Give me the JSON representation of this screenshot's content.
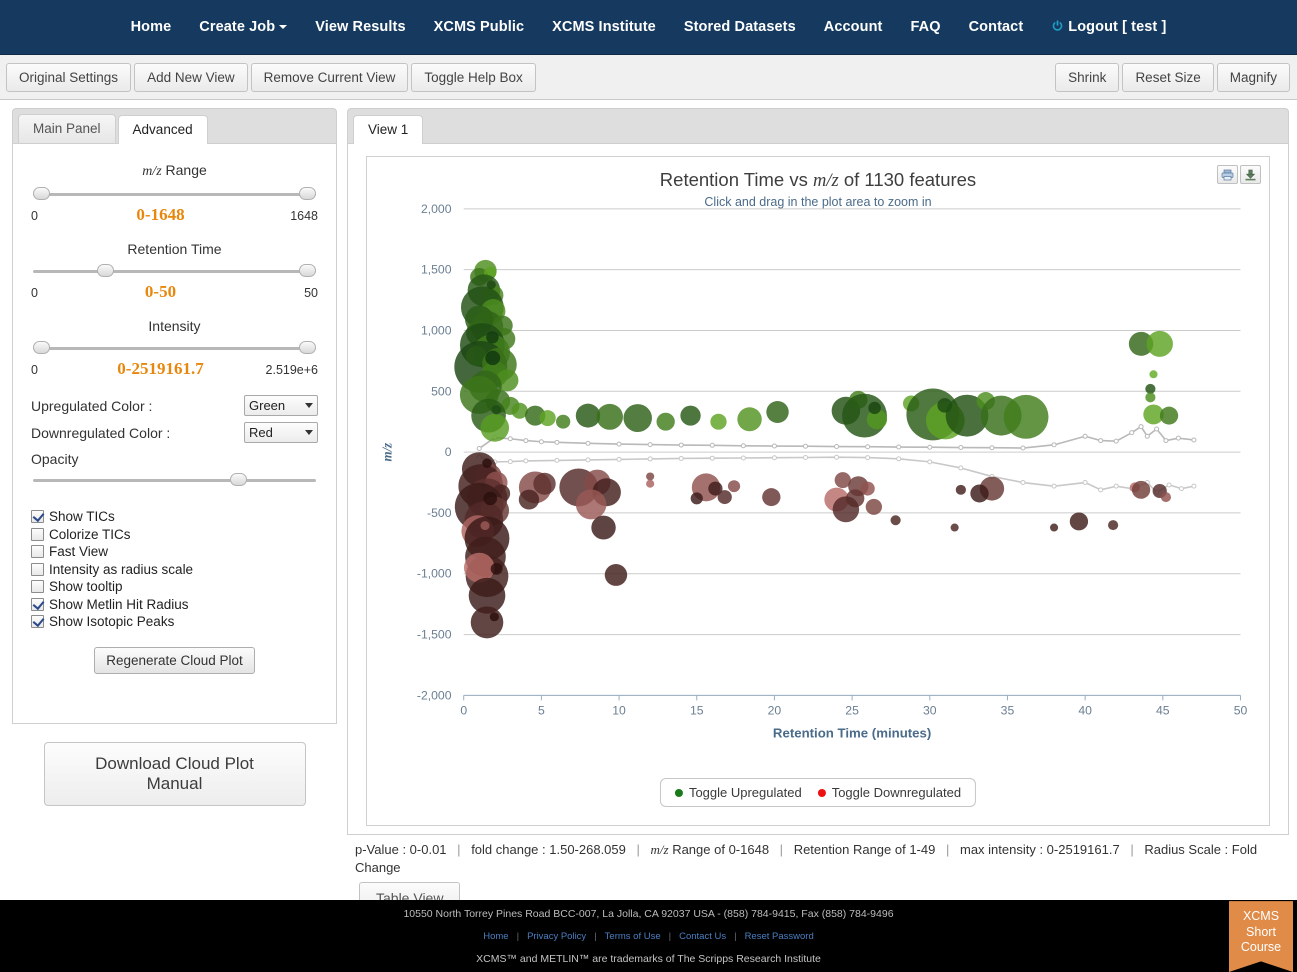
{
  "navbar": {
    "items": [
      {
        "label": "Home",
        "caret": false
      },
      {
        "label": "Create Job",
        "caret": true
      },
      {
        "label": "View Results",
        "caret": false
      },
      {
        "label": "XCMS Public",
        "caret": false
      },
      {
        "label": "XCMS Institute",
        "caret": false
      },
      {
        "label": "Stored Datasets",
        "caret": false
      },
      {
        "label": "Account",
        "caret": false
      },
      {
        "label": "FAQ",
        "caret": false
      },
      {
        "label": "Contact",
        "caret": false
      }
    ],
    "logout_label": "Logout [ test ]",
    "logout_icon": "power-icon",
    "bg_color": "#163a5f",
    "icon_color": "#1f9ec4"
  },
  "toolbar": {
    "left_buttons": [
      "Original Settings",
      "Add New View",
      "Remove Current View",
      "Toggle Help Box"
    ],
    "right_buttons": [
      "Shrink",
      "Reset Size",
      "Magnify"
    ]
  },
  "left_panel": {
    "tabs": [
      {
        "label": "Main Panel",
        "active": false
      },
      {
        "label": "Advanced",
        "active": true
      }
    ],
    "sliders": [
      {
        "name": "mz-range",
        "label_prefix": "m/z",
        "label_suffix": " Range",
        "low": "0",
        "value": "0-1648",
        "high": "1648",
        "handle_left_pct": 0,
        "handle_right_pct": 100
      },
      {
        "name": "retention-time",
        "label_prefix": "",
        "label_suffix": "Retention Time",
        "low": "0",
        "value": "0-50",
        "high": "50",
        "handle_left_pct": 24,
        "handle_right_pct": 100
      },
      {
        "name": "intensity",
        "label_prefix": "",
        "label_suffix": "Intensity",
        "low": "0",
        "value": "0-2519161.7",
        "high": "2.519e+6",
        "handle_left_pct": 0,
        "handle_right_pct": 100
      }
    ],
    "selects": [
      {
        "label": "Upregulated Color :",
        "value": "Green"
      },
      {
        "label": "Downregulated Color :",
        "value": "Red"
      }
    ],
    "opacity_label": "Opacity",
    "opacity_handle_pct": 74,
    "checkboxes": [
      {
        "label": "Show TICs",
        "checked": true
      },
      {
        "label": "Colorize TICs",
        "checked": false
      },
      {
        "label": "Fast View",
        "checked": false
      },
      {
        "label": "Intensity as radius scale",
        "checked": false
      },
      {
        "label": "Show tooltip",
        "checked": false
      },
      {
        "label": "Show Metlin Hit Radius",
        "checked": true
      },
      {
        "label": "Show Isotopic Peaks",
        "checked": true
      }
    ],
    "regenerate_label": "Regenerate Cloud Plot",
    "manual_label": "Download Cloud Plot Manual"
  },
  "right_panel": {
    "tabs": [
      {
        "label": "View 1",
        "active": true
      }
    ],
    "chart_icons": [
      "print-icon",
      "download-icon"
    ],
    "table_view_label": "Table View",
    "status": {
      "p_value": "p-Value : 0-0.01",
      "fold_change": "fold change : 1.50-268.059",
      "mz_range_prefix": "m/z",
      "mz_range_suffix": " Range of 0-1648",
      "retention_range": "Retention Range of 1-49",
      "max_intensity": "max intensity : 0-2519161.7",
      "radius_scale": "Radius Scale : Fold Change"
    }
  },
  "chart_data": {
    "type": "scatter",
    "title_prefix": "Retention Time vs ",
    "title_mz": "m/z",
    "title_suffix": " of 1130 features",
    "subtitle": "Click and drag in the plot area to zoom in",
    "xlabel": "Retention Time (minutes)",
    "ylabel": "m/z",
    "xlim": [
      0,
      50
    ],
    "ylim": [
      -2000,
      2000
    ],
    "xticks": [
      0,
      5,
      10,
      15,
      20,
      25,
      30,
      35,
      40,
      45,
      50
    ],
    "yticks": [
      -2000,
      -1500,
      -1000,
      -500,
      0,
      500,
      1000,
      1500,
      2000
    ],
    "yticklabels": [
      "-2,000",
      "-1,500",
      "-1,000",
      "-500",
      "0",
      "500",
      "1,000",
      "1,500",
      "2,000"
    ],
    "grid": true,
    "grid_color": "#cccccc",
    "legend_position": "bottom",
    "legend": [
      {
        "label": "Toggle Upregulated",
        "color": "#1a7a1a"
      },
      {
        "label": "Toggle Downregulated",
        "color": "#ee1111"
      }
    ],
    "feature_count": 1130,
    "series": [
      {
        "name": "Upregulated",
        "color_light": "#7dd02a",
        "color_dark": "#123a10",
        "points": [
          {
            "x": 1.4,
            "y": 1490,
            "r": 11,
            "shade": 0.45
          },
          {
            "x": 1.0,
            "y": 1440,
            "r": 9,
            "shade": 0.6
          },
          {
            "x": 1.7,
            "y": 1475,
            "r": 6,
            "shade": 0.3
          },
          {
            "x": 1.3,
            "y": 1330,
            "r": 16,
            "shade": 0.8
          },
          {
            "x": 1.9,
            "y": 1290,
            "r": 10,
            "shade": 0.5
          },
          {
            "x": 1.2,
            "y": 1190,
            "r": 21,
            "shade": 0.85
          },
          {
            "x": 1.9,
            "y": 1160,
            "r": 12,
            "shade": 0.45
          },
          {
            "x": 1.0,
            "y": 1090,
            "r": 14,
            "shade": 0.78
          },
          {
            "x": 1.5,
            "y": 1030,
            "r": 16,
            "shade": 0.72
          },
          {
            "x": 2.5,
            "y": 1040,
            "r": 10,
            "shade": 0.62
          },
          {
            "x": 1.0,
            "y": 980,
            "r": 13,
            "shade": 0.7
          },
          {
            "x": 2.6,
            "y": 930,
            "r": 11,
            "shade": 0.58
          },
          {
            "x": 1.2,
            "y": 880,
            "r": 22,
            "shade": 0.88
          },
          {
            "x": 1.8,
            "y": 820,
            "r": 18,
            "shade": 0.55
          },
          {
            "x": 0.8,
            "y": 790,
            "r": 10,
            "shade": 0.25
          },
          {
            "x": 1.1,
            "y": 700,
            "r": 26,
            "shade": 0.92
          },
          {
            "x": 2.3,
            "y": 720,
            "r": 17,
            "shade": 0.6
          },
          {
            "x": 2.0,
            "y": 640,
            "r": 13,
            "shade": 0.55
          },
          {
            "x": 2.8,
            "y": 590,
            "r": 11,
            "shade": 0.45
          },
          {
            "x": 1.4,
            "y": 540,
            "r": 16,
            "shade": 0.7
          },
          {
            "x": 1.0,
            "y": 470,
            "r": 19,
            "shade": 0.6
          },
          {
            "x": 2.2,
            "y": 420,
            "r": 12,
            "shade": 0.65
          },
          {
            "x": 3.0,
            "y": 380,
            "r": 9,
            "shade": 0.5
          },
          {
            "x": 3.6,
            "y": 340,
            "r": 8,
            "shade": 0.4
          },
          {
            "x": 1.6,
            "y": 300,
            "r": 17,
            "shade": 0.78
          },
          {
            "x": 2.0,
            "y": 200,
            "r": 14,
            "shade": 0.35
          },
          {
            "x": 4.6,
            "y": 300,
            "r": 10,
            "shade": 0.68
          },
          {
            "x": 5.4,
            "y": 280,
            "r": 8,
            "shade": 0.3
          },
          {
            "x": 6.4,
            "y": 250,
            "r": 7,
            "shade": 0.55
          },
          {
            "x": 8.0,
            "y": 300,
            "r": 12,
            "shade": 0.8
          },
          {
            "x": 9.4,
            "y": 290,
            "r": 13,
            "shade": 0.65
          },
          {
            "x": 11.2,
            "y": 280,
            "r": 14,
            "shade": 0.75
          },
          {
            "x": 13.0,
            "y": 250,
            "r": 9,
            "shade": 0.55
          },
          {
            "x": 14.6,
            "y": 300,
            "r": 10,
            "shade": 0.8
          },
          {
            "x": 16.4,
            "y": 250,
            "r": 8,
            "shade": 0.3
          },
          {
            "x": 18.4,
            "y": 270,
            "r": 12,
            "shade": 0.4
          },
          {
            "x": 20.2,
            "y": 330,
            "r": 11,
            "shade": 0.72
          },
          {
            "x": 24.6,
            "y": 340,
            "r": 14,
            "shade": 0.85
          },
          {
            "x": 25.4,
            "y": 430,
            "r": 9,
            "shade": 0.55
          },
          {
            "x": 25.8,
            "y": 300,
            "r": 22,
            "shade": 0.82
          },
          {
            "x": 26.6,
            "y": 270,
            "r": 10,
            "shade": 0.38
          },
          {
            "x": 28.8,
            "y": 400,
            "r": 8,
            "shade": 0.3
          },
          {
            "x": 30.2,
            "y": 310,
            "r": 26,
            "shade": 0.78
          },
          {
            "x": 31.0,
            "y": 260,
            "r": 19,
            "shade": 0.3
          },
          {
            "x": 32.4,
            "y": 300,
            "r": 21,
            "shade": 0.85
          },
          {
            "x": 33.6,
            "y": 420,
            "r": 9,
            "shade": 0.45
          },
          {
            "x": 34.6,
            "y": 300,
            "r": 20,
            "shade": 0.65
          },
          {
            "x": 36.2,
            "y": 290,
            "r": 22,
            "shade": 0.55
          },
          {
            "x": 43.6,
            "y": 890,
            "r": 12,
            "shade": 0.7
          },
          {
            "x": 44.8,
            "y": 890,
            "r": 13,
            "shade": 0.3
          },
          {
            "x": 44.4,
            "y": 640,
            "r": 4,
            "shade": 0.25
          },
          {
            "x": 44.2,
            "y": 520,
            "r": 5,
            "shade": 0.85
          },
          {
            "x": 44.2,
            "y": 450,
            "r": 5,
            "shade": 0.45
          },
          {
            "x": 44.4,
            "y": 310,
            "r": 10,
            "shade": 0.28
          },
          {
            "x": 45.4,
            "y": 300,
            "r": 9,
            "shade": 0.58
          }
        ]
      },
      {
        "name": "Downregulated",
        "color_light": "#f4948f",
        "color_dark": "#2b100e",
        "points": [
          {
            "x": 1.0,
            "y": -140,
            "r": 17,
            "shade": 0.9
          },
          {
            "x": 1.6,
            "y": -200,
            "r": 13,
            "shade": 0.6
          },
          {
            "x": 1.1,
            "y": -280,
            "r": 22,
            "shade": 0.88
          },
          {
            "x": 2.1,
            "y": -250,
            "r": 11,
            "shade": 0.5
          },
          {
            "x": 1.5,
            "y": -380,
            "r": 20,
            "shade": 0.75
          },
          {
            "x": 2.4,
            "y": -340,
            "r": 9,
            "shade": 0.85
          },
          {
            "x": 1.0,
            "y": -450,
            "r": 24,
            "shade": 0.92
          },
          {
            "x": 2.0,
            "y": -480,
            "r": 14,
            "shade": 0.7
          },
          {
            "x": 1.3,
            "y": -560,
            "r": 19,
            "shade": 0.8
          },
          {
            "x": 0.9,
            "y": -650,
            "r": 16,
            "shade": 0.35
          },
          {
            "x": 1.5,
            "y": -710,
            "r": 22,
            "shade": 0.93
          },
          {
            "x": 1.4,
            "y": -860,
            "r": 20,
            "shade": 0.9
          },
          {
            "x": 1.5,
            "y": -1020,
            "r": 21,
            "shade": 0.88
          },
          {
            "x": 1.0,
            "y": -950,
            "r": 15,
            "shade": 0.3
          },
          {
            "x": 1.5,
            "y": -1180,
            "r": 18,
            "shade": 0.92
          },
          {
            "x": 1.5,
            "y": -1400,
            "r": 16,
            "shade": 0.9
          },
          {
            "x": 4.6,
            "y": -290,
            "r": 16,
            "shade": 0.55
          },
          {
            "x": 5.2,
            "y": -260,
            "r": 11,
            "shade": 0.75
          },
          {
            "x": 4.2,
            "y": -390,
            "r": 10,
            "shade": 0.85
          },
          {
            "x": 7.4,
            "y": -290,
            "r": 19,
            "shade": 0.8
          },
          {
            "x": 8.6,
            "y": -250,
            "r": 13,
            "shade": 0.55
          },
          {
            "x": 9.2,
            "y": -330,
            "r": 14,
            "shade": 0.88
          },
          {
            "x": 8.2,
            "y": -430,
            "r": 15,
            "shade": 0.45
          },
          {
            "x": 9.0,
            "y": -620,
            "r": 12,
            "shade": 0.92
          },
          {
            "x": 9.8,
            "y": -1010,
            "r": 11,
            "shade": 0.9
          },
          {
            "x": 12.0,
            "y": -200,
            "r": 4,
            "shade": 0.6
          },
          {
            "x": 12.0,
            "y": -260,
            "r": 4,
            "shade": 0.38
          },
          {
            "x": 15.6,
            "y": -290,
            "r": 14,
            "shade": 0.5
          },
          {
            "x": 16.2,
            "y": -300,
            "r": 7,
            "shade": 0.9
          },
          {
            "x": 17.4,
            "y": -280,
            "r": 6,
            "shade": 0.55
          },
          {
            "x": 16.8,
            "y": -370,
            "r": 7,
            "shade": 0.8
          },
          {
            "x": 15.0,
            "y": -380,
            "r": 6,
            "shade": 0.92
          },
          {
            "x": 19.8,
            "y": -370,
            "r": 9,
            "shade": 0.72
          },
          {
            "x": 24.4,
            "y": -230,
            "r": 8,
            "shade": 0.58
          },
          {
            "x": 25.4,
            "y": -280,
            "r": 10,
            "shade": 0.68
          },
          {
            "x": 26.0,
            "y": -300,
            "r": 7,
            "shade": 0.5
          },
          {
            "x": 24.0,
            "y": -390,
            "r": 12,
            "shade": 0.3
          },
          {
            "x": 25.2,
            "y": -380,
            "r": 9,
            "shade": 0.72
          },
          {
            "x": 24.6,
            "y": -470,
            "r": 13,
            "shade": 0.8
          },
          {
            "x": 26.4,
            "y": -450,
            "r": 8,
            "shade": 0.6
          },
          {
            "x": 27.8,
            "y": -560,
            "r": 5,
            "shade": 0.85
          },
          {
            "x": 32.0,
            "y": -310,
            "r": 5,
            "shade": 0.88
          },
          {
            "x": 34.0,
            "y": -300,
            "r": 12,
            "shade": 0.7
          },
          {
            "x": 33.2,
            "y": -340,
            "r": 9,
            "shade": 0.92
          },
          {
            "x": 31.6,
            "y": -620,
            "r": 4,
            "shade": 0.85
          },
          {
            "x": 38.0,
            "y": -620,
            "r": 4,
            "shade": 0.88
          },
          {
            "x": 39.6,
            "y": -570,
            "r": 9,
            "shade": 0.9
          },
          {
            "x": 41.8,
            "y": -600,
            "r": 5,
            "shade": 0.85
          },
          {
            "x": 43.2,
            "y": -290,
            "r": 5,
            "shade": 0.3
          },
          {
            "x": 43.6,
            "y": -310,
            "r": 9,
            "shade": 0.65
          },
          {
            "x": 44.8,
            "y": -320,
            "r": 7,
            "shade": 0.8
          },
          {
            "x": 45.2,
            "y": -370,
            "r": 5,
            "shade": 0.5
          }
        ]
      }
    ],
    "tic_upregulated": {
      "color": "#b9b9b9",
      "x": [
        1.0,
        2.0,
        3.0,
        4.0,
        5.0,
        6.0,
        8.0,
        10.0,
        12.0,
        14.0,
        16.0,
        18.0,
        20.0,
        22.0,
        24.0,
        26.0,
        28.0,
        30.0,
        32.0,
        34.0,
        36.0,
        38.0,
        40.0,
        41.0,
        42.0,
        43.0,
        43.6,
        44.0,
        44.6,
        45.2,
        46.0,
        47.0
      ],
      "y": [
        30,
        120,
        110,
        95,
        85,
        80,
        72,
        66,
        62,
        58,
        56,
        52,
        50,
        48,
        46,
        44,
        42,
        40,
        38,
        36,
        34,
        60,
        130,
        95,
        90,
        160,
        210,
        130,
        190,
        95,
        115,
        100
      ]
    },
    "tic_downregulated": {
      "color": "#c8c8c8",
      "x": [
        1.0,
        2.0,
        3.0,
        4.0,
        6.0,
        8.0,
        10.0,
        12.0,
        14.0,
        16.0,
        18.0,
        20.0,
        22.0,
        24.0,
        26.0,
        28.0,
        30.0,
        32.0,
        34.0,
        36.0,
        38.0,
        40.0,
        41.0,
        42.0,
        43.0,
        44.0,
        44.6,
        45.4,
        46.2,
        47.0
      ],
      "y": [
        -40,
        -80,
        -78,
        -72,
        -68,
        -64,
        -60,
        -56,
        -52,
        -50,
        -48,
        -46,
        -44,
        -42,
        -45,
        -55,
        -80,
        -130,
        -200,
        -250,
        -280,
        -250,
        -310,
        -280,
        -300,
        -250,
        -330,
        -270,
        -300,
        -280
      ]
    }
  },
  "footer": {
    "address": "10550 North Torrey Pines Road BCC-007, La Jolla, CA 92037 USA - (858) 784-9415, Fax (858) 784-9496",
    "links": [
      "Home",
      "Privacy Policy",
      "Terms of Use",
      "Contact Us",
      "Reset Password"
    ],
    "trademark": "XCMS™ and METLIN™ are trademarks of The Scripps Research Institute",
    "short_course_lines": [
      "XCMS",
      "Short",
      "Course"
    ],
    "short_course_color": "#e08b48"
  }
}
